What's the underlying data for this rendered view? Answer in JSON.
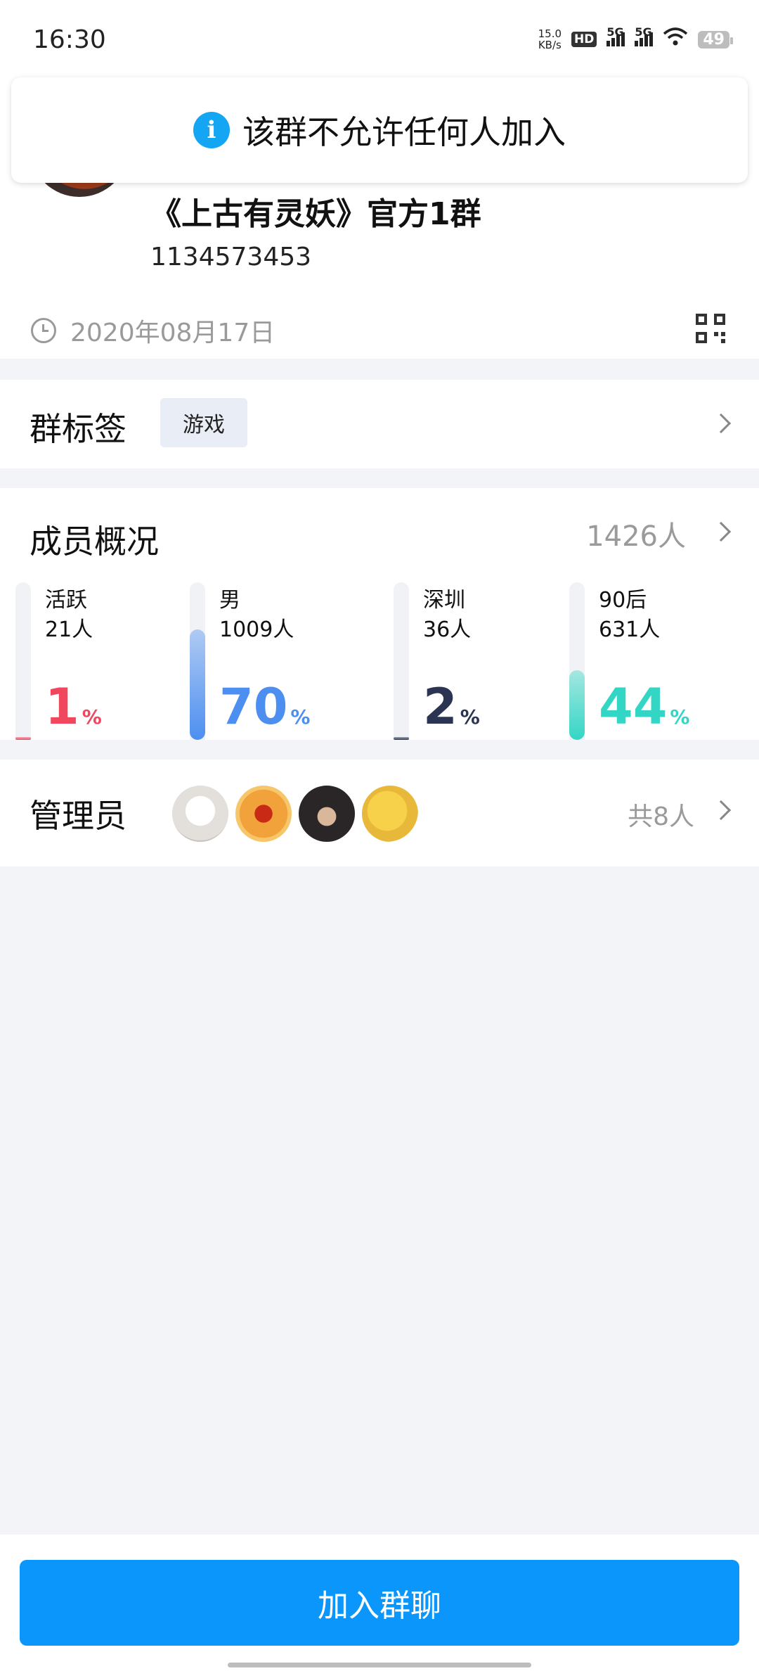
{
  "status_bar": {
    "time": "16:30",
    "net_speed_value": "15.0",
    "net_speed_unit": "KB/s",
    "hd_label": "HD",
    "sim1_label": "5G",
    "sim2_label": "5G",
    "battery": "49"
  },
  "toast": {
    "icon": "info-icon",
    "text": "该群不允许任何人加入"
  },
  "group": {
    "name": "《上古有灵妖》官方1群",
    "id": "1134573453",
    "created_date": "2020年08月17日"
  },
  "tags": {
    "title": "群标签",
    "items": [
      "游戏"
    ]
  },
  "members": {
    "title": "成员概况",
    "total": "1426人",
    "stats": [
      {
        "label": "活跃",
        "count": "21人",
        "percent": 1,
        "unit": "%",
        "color": "#f0475f"
      },
      {
        "label": "男",
        "count": "1009人",
        "percent": 70,
        "unit": "%",
        "color": "#4d8ff0"
      },
      {
        "label": "深圳",
        "count": "36人",
        "percent": 2,
        "unit": "%",
        "color": "#2b3552"
      },
      {
        "label": "90后",
        "count": "631人",
        "percent": 44,
        "unit": "%",
        "color": "#33d6c4"
      }
    ]
  },
  "admins": {
    "title": "管理员",
    "count_text": "共8人",
    "avatars": [
      "white-cat-avatar",
      "superman-avatar",
      "anime-boy-avatar",
      "duck-avatar"
    ]
  },
  "join_button": {
    "label": "加入群聊"
  },
  "colors": {
    "accent": "#0a96fa",
    "info": "#14a5f3"
  }
}
